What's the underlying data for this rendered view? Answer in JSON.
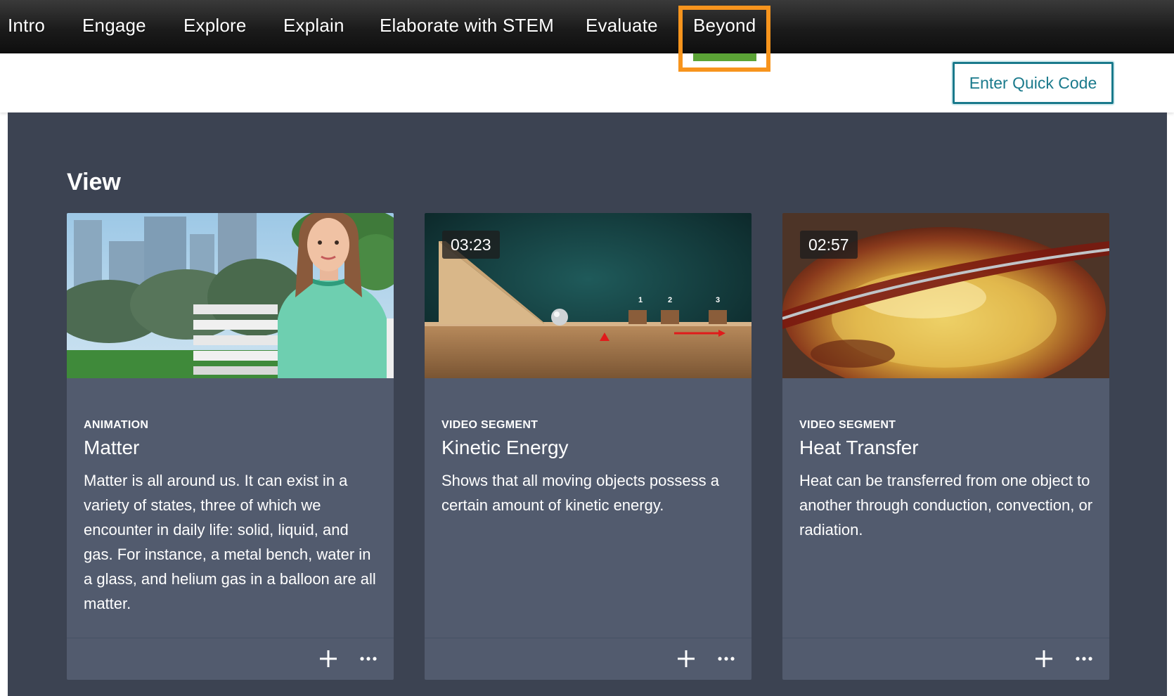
{
  "nav": {
    "items": [
      {
        "label": "Intro"
      },
      {
        "label": "Engage"
      },
      {
        "label": "Explore"
      },
      {
        "label": "Explain"
      },
      {
        "label": "Elaborate with STEM"
      },
      {
        "label": "Evaluate"
      },
      {
        "label": "Beyond"
      }
    ],
    "active_index": 6,
    "highlight_color": "#f7941d",
    "active_color": "#5ba336"
  },
  "header": {
    "quick_code_label": "Enter Quick Code",
    "accent_color": "#1a7a8c"
  },
  "section": {
    "title": "View"
  },
  "cards": [
    {
      "type": "ANIMATION",
      "title": "Matter",
      "duration": "",
      "description": "Matter is all around us. It can exist in a variety of states, three of which we encounter in daily life: solid, liquid, and gas. For instance, a metal bench, water in a glass, and helium gas in a balloon are all matter.",
      "thumbnail_icon": "park-animation-thumbnail"
    },
    {
      "type": "VIDEO SEGMENT",
      "title": "Kinetic Energy",
      "duration": "03:23",
      "description": "Shows that all moving objects possess a certain amount of kinetic energy.",
      "thumbnail_icon": "ramp-ball-thumbnail",
      "thumbnail_labels": [
        "1",
        "2",
        "3"
      ]
    },
    {
      "type": "VIDEO SEGMENT",
      "title": "Heat Transfer",
      "duration": "02:57",
      "description": "Heat can be transferred from one object to another through conduction, convection, or radiation.",
      "thumbnail_icon": "heated-glass-thumbnail"
    }
  ],
  "card_actions": {
    "add_icon": "plus-icon",
    "more_icon": "more-horizontal-icon"
  }
}
